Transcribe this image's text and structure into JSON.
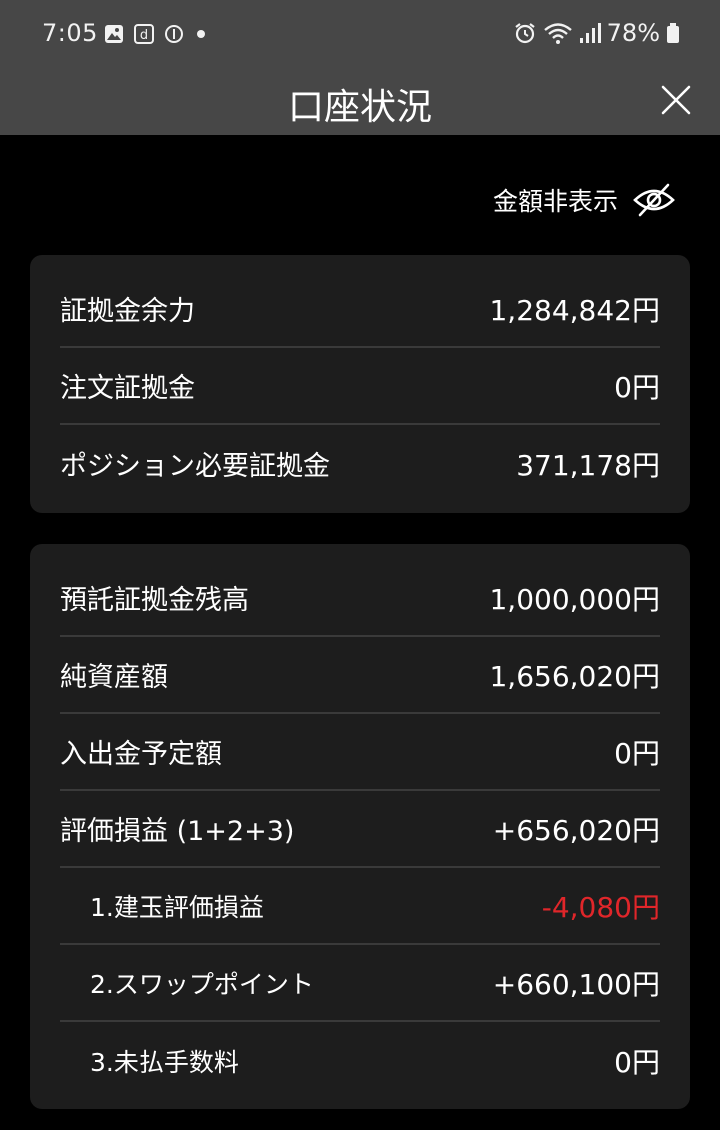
{
  "status_bar": {
    "time": "7:05",
    "battery": "78%",
    "icons": [
      "gallery-icon",
      "d-app-icon",
      "info-icon",
      "dot-icon",
      "alarm-icon",
      "wifi-icon",
      "signal-icon",
      "battery-icon"
    ]
  },
  "header": {
    "title": "口座状況",
    "close_icon": "close-icon"
  },
  "toggle": {
    "label": "金額非表示",
    "icon": "eye-off-icon"
  },
  "margin_card": {
    "rows": [
      {
        "label": "証拠金余力",
        "value": "1,284,842円"
      },
      {
        "label": "注文証拠金",
        "value": "0円"
      },
      {
        "label": "ポジション必要証拠金",
        "value": "371,178円"
      }
    ]
  },
  "balance_card": {
    "rows": [
      {
        "label": "預託証拠金残高",
        "value": "1,000,000円"
      },
      {
        "label": "純資産額",
        "value": "1,656,020円"
      },
      {
        "label": "入出金予定額",
        "value": "0円"
      },
      {
        "label": "評価損益 (1+2+3)",
        "value": "+656,020円"
      },
      {
        "label": "1.建玉評価損益",
        "value": "-4,080円"
      },
      {
        "label": "2.スワップポイント",
        "value": "+660,100円"
      },
      {
        "label": "3.未払手数料",
        "value": "0円"
      }
    ]
  },
  "colors": {
    "background": "#000000",
    "header": "#474747",
    "card": "#1d1d1d",
    "negative": "#e0262a"
  }
}
